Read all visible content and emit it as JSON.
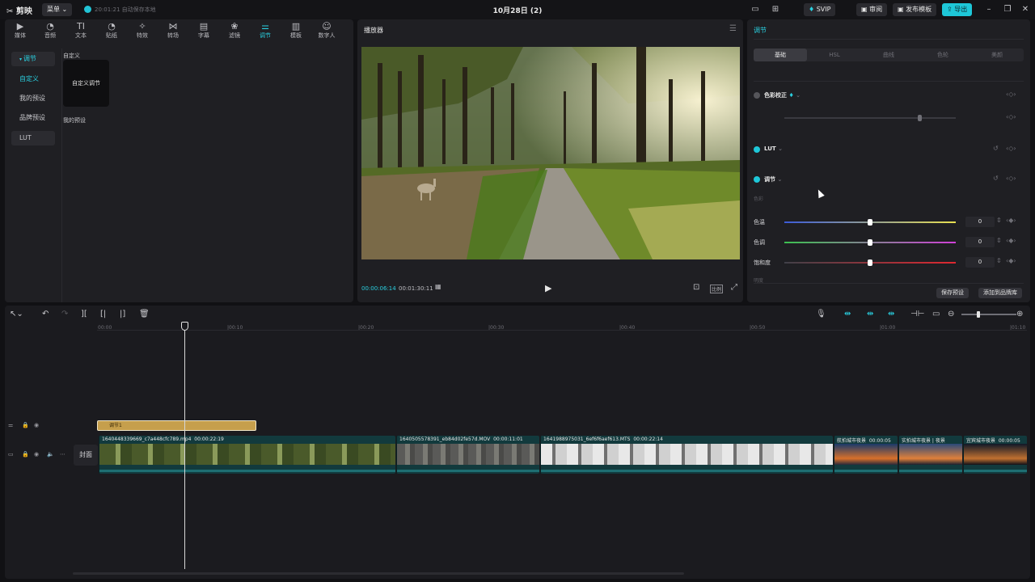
{
  "titlebar": {
    "app_name": "剪映",
    "menu_label": "菜单",
    "autosave_text": "20:01:21 自动保存本地",
    "project_title": "10月28日 (2)",
    "svip_label": "SVIP",
    "review_label": "审阅",
    "publish_label": "发布模板",
    "export_label": "导出"
  },
  "media": {
    "tools": [
      {
        "icon": "media-icon",
        "label": "媒体"
      },
      {
        "icon": "audio-icon",
        "label": "音频"
      },
      {
        "icon": "text-icon",
        "label": "文本"
      },
      {
        "icon": "sticker-icon",
        "label": "贴纸"
      },
      {
        "icon": "effects-icon",
        "label": "特效"
      },
      {
        "icon": "transition-icon",
        "label": "转场"
      },
      {
        "icon": "caption-icon",
        "label": "字幕"
      },
      {
        "icon": "filter-icon",
        "label": "滤镜"
      },
      {
        "icon": "adjust-icon",
        "label": "调节"
      },
      {
        "icon": "template-icon",
        "label": "模板"
      },
      {
        "icon": "digital-human-icon",
        "label": "数字人"
      }
    ],
    "sidebar": {
      "header": "调节",
      "items": [
        "自定义",
        "我的预设",
        "品牌预设",
        "LUT"
      ]
    },
    "section_custom": "自定义",
    "preset_card_label": "自定义调节",
    "section_my_presets": "我的预设"
  },
  "player": {
    "title": "播放器",
    "current_time": "00:00:06:14",
    "total_time": "00:01:30:11",
    "aspect_label": "比例"
  },
  "adjust": {
    "title": "调节",
    "tabs": [
      "基础",
      "HSL",
      "曲线",
      "色轮",
      "美颜"
    ],
    "sections": {
      "color_correction": "色彩校正",
      "lut": "LUT",
      "adjust": "调节",
      "color_sub": "色彩",
      "next_sub": "明度"
    },
    "sliders": [
      {
        "label": "色温",
        "value": "0"
      },
      {
        "label": "色调",
        "value": "0"
      },
      {
        "label": "饱和度",
        "value": "0"
      }
    ],
    "save_preset_label": "保存预设",
    "add_brand_label": "添加到品牌库"
  },
  "timeline": {
    "ruler": [
      "00:00",
      "|00:10",
      "|00:20",
      "|00:30",
      "|00:40",
      "|00:50",
      "|01:00",
      "|01:10"
    ],
    "cover_label": "封面",
    "adjust_clip_label": "调节1",
    "clips": [
      {
        "name": "1640448339669_c7a448cfc789.mp4",
        "duration": "00:00:22:19"
      },
      {
        "name": "1640505578391_eb84d02fe57d.MOV",
        "duration": "00:00:11:01"
      },
      {
        "name": "1641988975031_6ef6f6aef613.MTS",
        "duration": "00:00:22:14"
      },
      {
        "name": "航拍城市夜景",
        "duration": "00:00:05"
      },
      {
        "name": "实拍城市夜景 | 夜景",
        "duration": ""
      },
      {
        "name": "宜宾城市夜景",
        "duration": "00:00:05"
      }
    ]
  },
  "colors": {
    "accent": "#1ec7d8",
    "panel": "#1f1f23",
    "background": "#111114",
    "adjust_clip": "#c69f4c",
    "video_clip": "#123a3d"
  }
}
